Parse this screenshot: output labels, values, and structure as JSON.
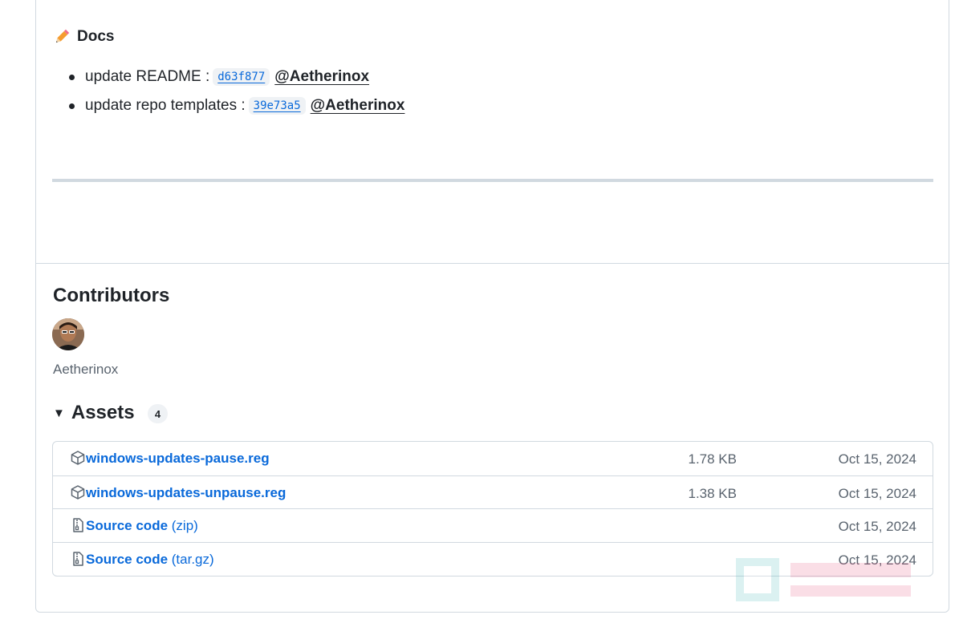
{
  "docs": {
    "heading": "Docs",
    "items": [
      {
        "text": "update README :",
        "sha": "d63f877",
        "author": "@Aetherinox"
      },
      {
        "text": "update repo templates :",
        "sha": "39e73a5",
        "author": "@Aetherinox"
      }
    ]
  },
  "contributors": {
    "title": "Contributors",
    "names": [
      "Aetherinox"
    ]
  },
  "assets": {
    "title": "Assets",
    "count": "4",
    "rows": [
      {
        "name": "windows-updates-pause.reg",
        "suffix": "",
        "size": "1.78 KB",
        "date": "Oct 15, 2024",
        "icon": "package-icon"
      },
      {
        "name": "windows-updates-unpause.reg",
        "suffix": "",
        "size": "1.38 KB",
        "date": "Oct 15, 2024",
        "icon": "package-icon"
      },
      {
        "name": "Source code",
        "suffix": " (zip)",
        "size": "",
        "date": "Oct 15, 2024",
        "icon": "file-zip-icon"
      },
      {
        "name": "Source code",
        "suffix": " (tar.gz)",
        "size": "",
        "date": "Oct 15, 2024",
        "icon": "file-zip-icon"
      }
    ]
  },
  "colors": {
    "link": "#0969da",
    "muted": "#59636e",
    "border": "#d1d9e0"
  }
}
